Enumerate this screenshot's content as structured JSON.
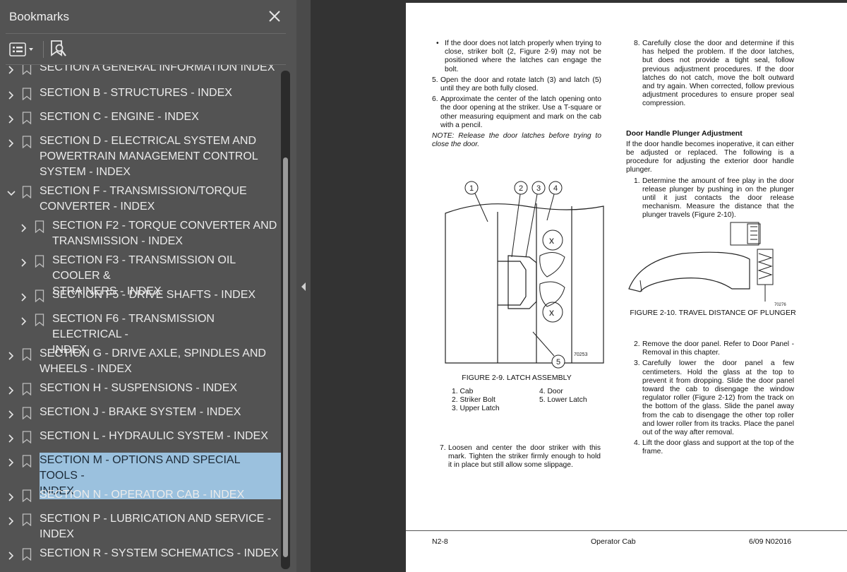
{
  "panel": {
    "title": "Bookmarks",
    "close_icon": "close-icon",
    "options_icon": "list-options-icon",
    "find_icon": "bookmark-find-icon",
    "selected_color": "#9bc1de"
  },
  "bookmarks": [
    {
      "label": "SECTION A GENERAL INFORMATION INDEX",
      "expanded": false,
      "level": 0
    },
    {
      "label": "SECTION B - STRUCTURES - INDEX",
      "expanded": false,
      "level": 0
    },
    {
      "label": "SECTION C - ENGINE - INDEX",
      "expanded": false,
      "level": 0
    },
    {
      "label": "SECTION D - ELECTRICAL SYSTEM AND\nPOWERTRAIN MANAGEMENT CONTROL\nSYSTEM - INDEX",
      "expanded": false,
      "level": 0
    },
    {
      "label": "SECTION F - TRANSMISSION/TORQUE\nCONVERTER - INDEX",
      "expanded": true,
      "level": 0
    },
    {
      "label": "SECTION F2 - TORQUE CONVERTER AND\nTRANSMISSION - INDEX",
      "expanded": false,
      "level": 1
    },
    {
      "label": "SECTION F3 - TRANSMISSION OIL COOLER &\nSTRAINERS - INDEX",
      "expanded": false,
      "level": 1
    },
    {
      "label": "SECTION F5 - DRIVE SHAFTS - INDEX",
      "expanded": false,
      "level": 1
    },
    {
      "label": "SECTION F6 - TRANSMISSION ELECTRICAL -\nINDEX",
      "expanded": false,
      "level": 1
    },
    {
      "label": "SECTION G - DRIVE AXLE, SPINDLES AND\nWHEELS - INDEX",
      "expanded": false,
      "level": 0
    },
    {
      "label": "SECTION H - SUSPENSIONS - INDEX",
      "expanded": false,
      "level": 0
    },
    {
      "label": "SECTION J - BRAKE SYSTEM - INDEX",
      "expanded": false,
      "level": 0
    },
    {
      "label": "SECTION L - HYDRAULIC SYSTEM -  INDEX",
      "expanded": false,
      "level": 0
    },
    {
      "label": "SECTION M - OPTIONS AND SPECIAL TOOLS -\nINDEX",
      "expanded": false,
      "level": 0,
      "selected": true
    },
    {
      "label": "SECTION N - OPERATOR CAB - INDEX",
      "expanded": false,
      "level": 0
    },
    {
      "label": "SECTION P - LUBRICATION AND SERVICE -\nINDEX",
      "expanded": false,
      "level": 0
    },
    {
      "label": "SECTION R - SYSTEM SCHEMATICS - INDEX",
      "expanded": false,
      "level": 0
    }
  ],
  "document": {
    "left_col": {
      "bullet": "If the door does not latch properly when trying to close, striker bolt (2, Figure 2-9) may not be positioned where the latches can engage the bolt.",
      "step5": "Open the door and rotate latch (3) and latch (5) until they are both fully closed.",
      "step6": "Approximate the center of the latch opening onto the door opening at the striker. Use a T-square or other measuring equipment and mark on the cab with a pencil.",
      "note": "NOTE: Release the door latches before trying to close the door.",
      "fig_caption": "FIGURE 2-9. LATCH ASSEMBLY",
      "fig_code": "70253",
      "callouts": [
        "1",
        "2",
        "3",
        "4",
        "5"
      ],
      "legend": [
        "1. Cab",
        "2. Striker Bolt",
        "3. Upper Latch",
        "4. Door",
        "5. Lower Latch"
      ],
      "step7": "Loosen and center the door striker with this mark. Tighten the striker firmly enough to hold it in place but still allow some slippage."
    },
    "right_col": {
      "step8": "Carefully close the door and determine if this has helped the problem. If the door latches, but does not provide a tight seal, follow previous adjustment procedures. If the door latches do not catch, move the bolt outward and try again. When corrected, follow previous adjustment procedures to ensure proper seal compression.",
      "heading": "Door Handle Plunger Adjustment",
      "intro": "If the door handle becomes inoperative, it can either be adjusted or replaced. The following is a procedure for adjusting the exterior door handle plunger.",
      "step1": "Determine the amount of free play in the door release plunger by pushing in on the plunger until it just contacts the door release mechanism. Measure the distance that the plunger travels (Figure 2-10).",
      "fig_caption": "FIGURE 2-10. TRAVEL DISTANCE OF PLUNGER",
      "fig_code": "70276",
      "step2": "Remove the door panel. Refer to Door Panel - Removal in this chapter.",
      "step3": "Carefully lower the door panel a few centimeters. Hold the glass at the top to prevent it from dropping. Slide the door panel toward the cab to disengage the window regulator roller (Figure 2-12) from the track on the bottom of the glass. Slide the panel away from the cab to disengage the other top roller and lower roller from its tracks. Place the panel out of the way after removal.",
      "step4": "Lift the door glass and support at the top of the frame."
    },
    "footer": {
      "left": "N2-8",
      "center": "Operator Cab",
      "right": "6/09   N02016"
    }
  }
}
